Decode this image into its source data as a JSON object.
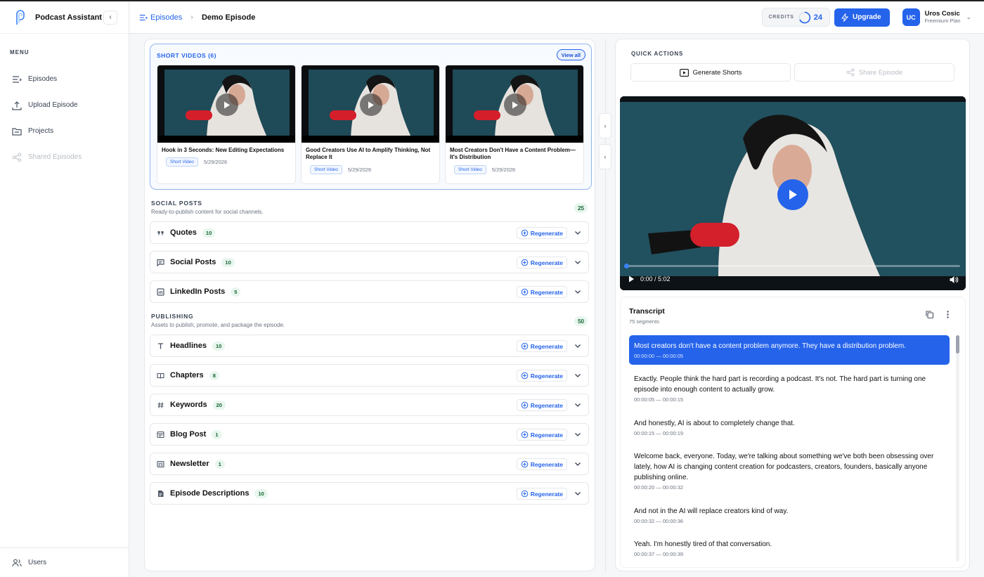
{
  "app": {
    "brand": "Podcast Assistant"
  },
  "sidebar": {
    "menu_label": "MENU",
    "items": [
      {
        "label": "Episodes"
      },
      {
        "label": "Upload Episode"
      },
      {
        "label": "Projects"
      },
      {
        "label": "Shared Episodes"
      }
    ],
    "footer_item": {
      "label": "Users"
    }
  },
  "header": {
    "breadcrumb_parent": "Episodes",
    "breadcrumb_current": "Demo Episode",
    "credits_label": "CREDITS",
    "credits_value": "24",
    "upgrade_label": "Upgrade",
    "user_initials": "UC",
    "user_name": "Uros Cosic",
    "user_plan": "Freemium Plan"
  },
  "shorts": {
    "title": "SHORT VIDEOS (6)",
    "view_all": "View all",
    "cards": [
      {
        "title": "Hook in 3 Seconds: New Editing Expectations",
        "badge": "Short Video",
        "date": "5/29/2026"
      },
      {
        "title": "Good Creators Use AI to Amplify Thinking, Not Replace It",
        "badge": "Short Video",
        "date": "5/29/2026"
      },
      {
        "title": "Most Creators Don't Have a Content Problem—It's Distribution",
        "badge": "Short Video",
        "date": "5/29/2026"
      }
    ]
  },
  "social": {
    "title": "SOCIAL POSTS",
    "subtitle": "Ready-to-publish content for social channels.",
    "count": "25",
    "rows": [
      {
        "label": "Quotes",
        "count": "10",
        "action": "Regenerate"
      },
      {
        "label": "Social Posts",
        "count": "10",
        "action": "Regenerate"
      },
      {
        "label": "LinkedIn Posts",
        "count": "5",
        "action": "Regenerate"
      }
    ]
  },
  "publishing": {
    "title": "PUBLISHING",
    "subtitle": "Assets to publish, promote, and package the episode.",
    "count": "50",
    "rows": [
      {
        "label": "Headlines",
        "count": "10",
        "action": "Regenerate"
      },
      {
        "label": "Chapters",
        "count": "8",
        "action": "Regenerate"
      },
      {
        "label": "Keywords",
        "count": "20",
        "action": "Regenerate"
      },
      {
        "label": "Blog Post",
        "count": "1",
        "action": "Regenerate"
      },
      {
        "label": "Newsletter",
        "count": "1",
        "action": "Regenerate"
      },
      {
        "label": "Episode Descriptions",
        "count": "10",
        "action": "Regenerate"
      }
    ]
  },
  "quick_actions": {
    "title": "QUICK ACTIONS",
    "generate_shorts": "Generate Shorts",
    "share_episode": "Share Episode"
  },
  "player": {
    "time": "0:00 / 5:02",
    "progress": 0
  },
  "transcript": {
    "title": "Transcript",
    "subtitle": "75 segments",
    "segments": [
      {
        "text": "Most creators don't have a content problem anymore. They have a distribution problem.",
        "time": "00:00:00 — 00:00:05"
      },
      {
        "text": "Exactly. People think the hard part is recording a podcast. It's not. The hard part is turning one episode into enough content to actually grow.",
        "time": "00:00:05 — 00:00:15"
      },
      {
        "text": "And honestly, AI is about to completely change that.",
        "time": "00:00:15 — 00:00:19"
      },
      {
        "text": "Welcome back, everyone. Today, we're talking about something we've both been obsessing over lately, how AI is changing content creation for podcasters, creators, founders, basically anyone publishing online.",
        "time": "00:00:20 — 00:00:32"
      },
      {
        "text": "And not in the AI will replace creators kind of way.",
        "time": "00:00:32 — 00:00:36"
      },
      {
        "text": "Yeah. I'm honestly tired of that conversation.",
        "time": "00:00:37 — 00:00:39"
      }
    ]
  },
  "colors": {
    "accent": "#2563eb",
    "count_badge_bg": "#e8f6ee",
    "count_badge_text": "#166534"
  }
}
